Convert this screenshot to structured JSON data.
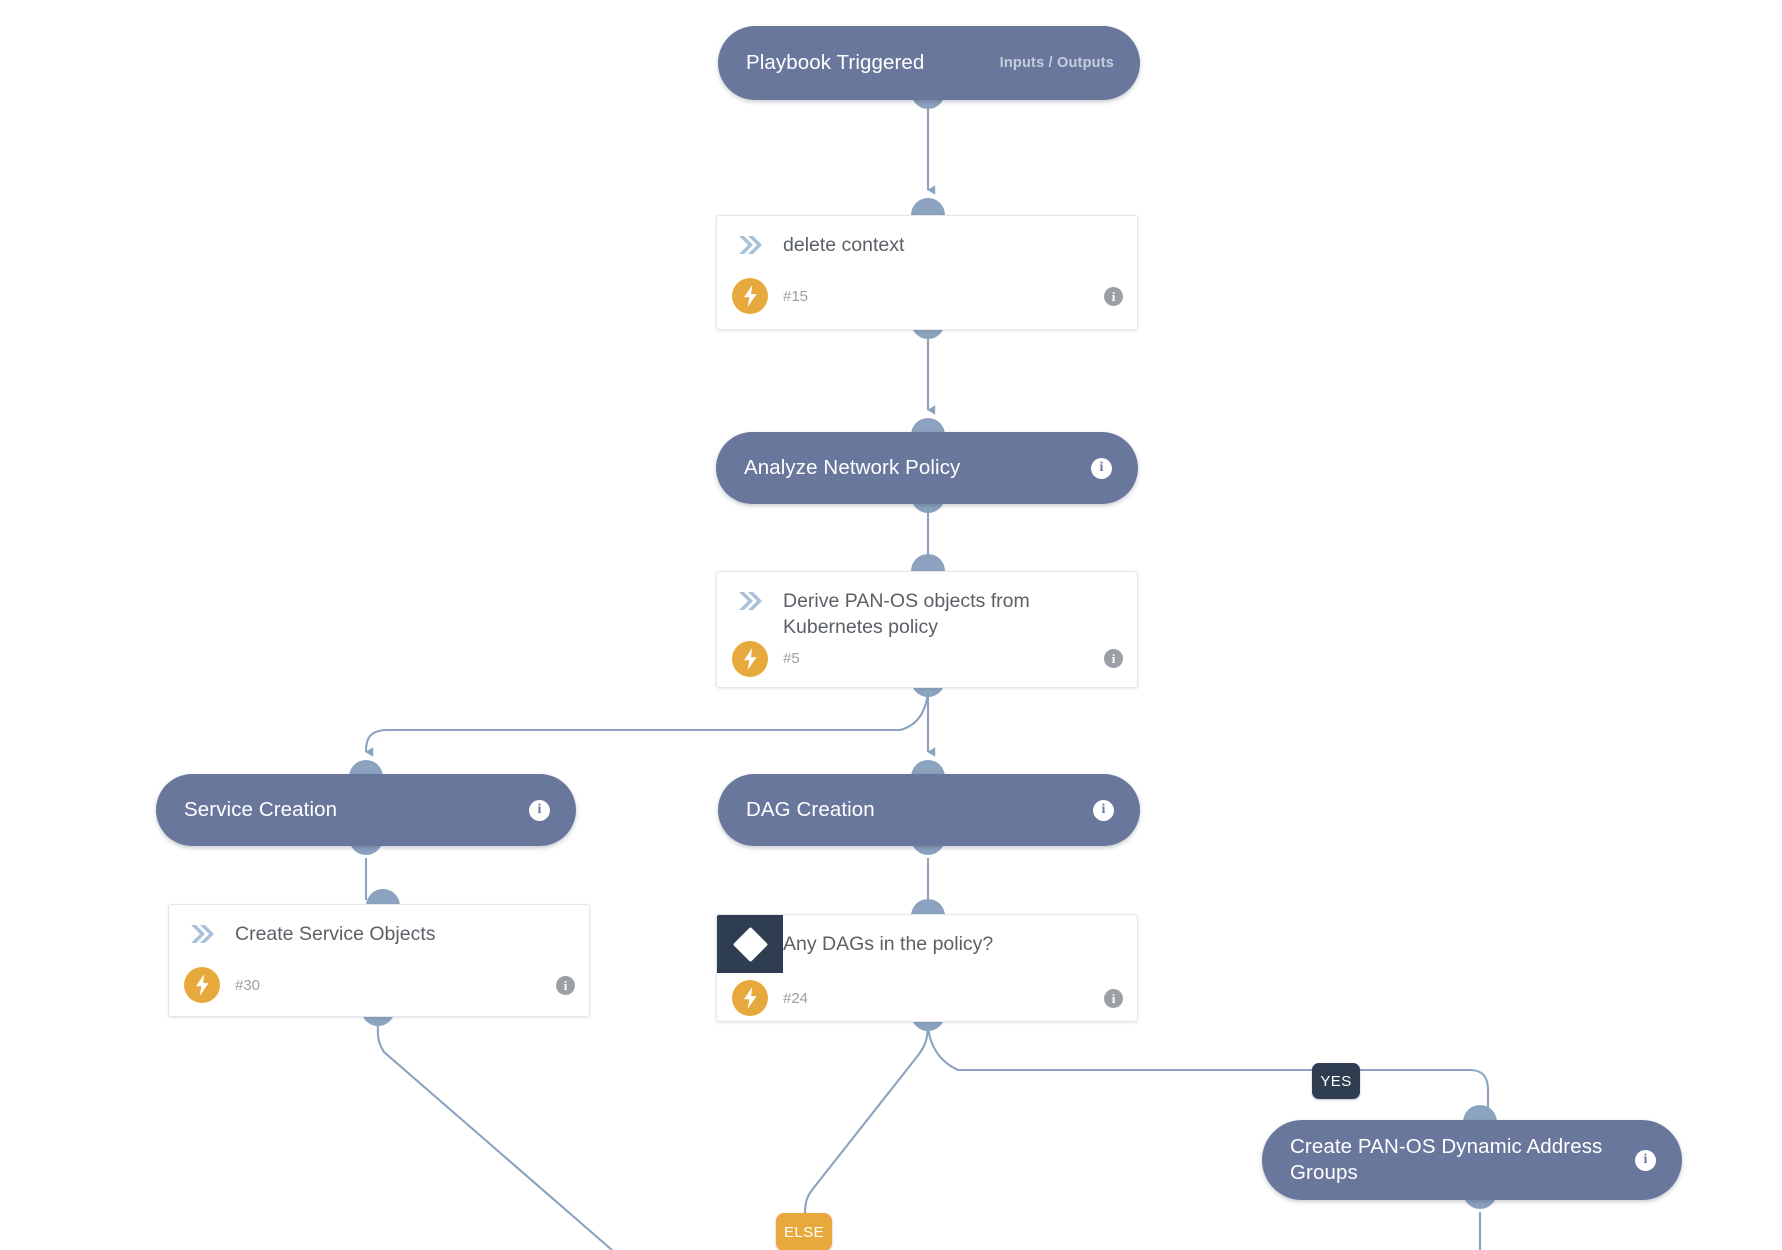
{
  "diagram": {
    "title": "Playbook Workflow",
    "colors": {
      "pill": "#68779b",
      "card_bg": "#ffffff",
      "card_border": "#e3e6ea",
      "edge": "#8ba3bf",
      "port": "#8ba3bf",
      "bolt_badge": "#e7a93c",
      "condition_block": "#2e3e50",
      "yes_badge": "#2e3e50",
      "else_badge": "#e7a93c",
      "title_text": "#5b6066",
      "id_text": "#9aa0a6"
    }
  },
  "nodes": {
    "playbook_triggered": {
      "label": "Playbook Triggered",
      "io_label": "Inputs / Outputs",
      "type": "pill"
    },
    "delete_context": {
      "title": "delete  context",
      "id": "#15",
      "type": "task",
      "icon": "chevron-double-right-icon",
      "badge": "bolt-icon",
      "info": "i"
    },
    "analyze_network_policy": {
      "label": "Analyze Network Policy",
      "type": "pill",
      "info": "i"
    },
    "derive_panos_objects": {
      "title": "Derive PAN-OS objects from Kubernetes policy",
      "id": "#5",
      "type": "task",
      "icon": "chevron-double-right-icon",
      "badge": "bolt-icon",
      "info": "i"
    },
    "service_creation": {
      "label": "Service Creation",
      "type": "pill",
      "info": "i"
    },
    "dag_creation": {
      "label": "DAG Creation",
      "type": "pill",
      "info": "i"
    },
    "create_service_objects": {
      "title": "Create Service Objects",
      "id": "#30",
      "type": "task",
      "icon": "chevron-double-right-icon",
      "badge": "bolt-icon",
      "info": "i"
    },
    "any_dags_condition": {
      "title": "Any DAGs in the policy?",
      "id": "#24",
      "type": "condition",
      "icon": "diamond-icon",
      "badge": "bolt-icon",
      "info": "i"
    },
    "create_panos_dag": {
      "label": "Create PAN-OS Dynamic Address Groups",
      "type": "pill",
      "info": "i"
    }
  },
  "branches": {
    "yes": "YES",
    "else": "ELSE"
  }
}
